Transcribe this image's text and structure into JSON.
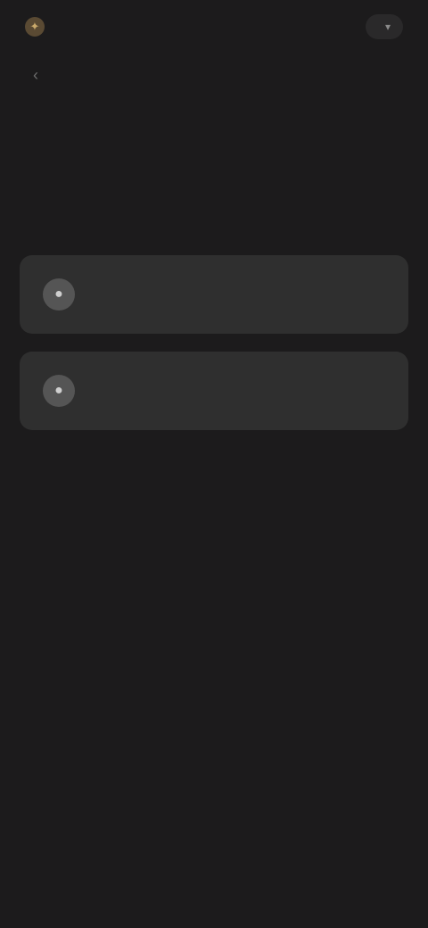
{
  "header": {
    "brand_icon": "star-icon",
    "brand_name": "",
    "action_label": "",
    "action_icon": "chevron-down-icon"
  },
  "sub_bar": {
    "back_icon": "back-arrow-icon",
    "text": ""
  },
  "main": {
    "heading": "",
    "options": [
      {
        "icon": "option-icon",
        "label": ""
      },
      {
        "icon": "option-icon",
        "label": ""
      }
    ]
  },
  "colors": {
    "background": "#1c1b1c",
    "card": "#2f2f2f",
    "accent": "#c9a96b"
  }
}
